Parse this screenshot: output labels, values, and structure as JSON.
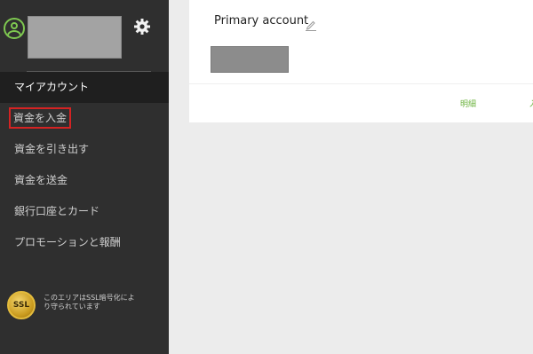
{
  "sidebar": {
    "nav_items": [
      {
        "label": "マイアカウント"
      },
      {
        "label": "資金を入金"
      },
      {
        "label": "資金を引き出す"
      },
      {
        "label": "資金を送金"
      },
      {
        "label": "銀行口座とカード"
      },
      {
        "label": "プロモーションと報酬"
      }
    ],
    "active_index": 0,
    "highlighted_index": 1,
    "ssl_badge_text": "SSL",
    "ssl_notice": "このエリアはSSL暗号化により守られています"
  },
  "main": {
    "account_title": "Primary account",
    "detail_link": "明細",
    "extra_link": "入"
  },
  "colors": {
    "sidebar_bg": "#2f2f2f",
    "active_bg": "#1f1f1f",
    "accent_green": "#6db33f",
    "highlight_red": "#d42323"
  },
  "icons": {
    "avatar": "user-avatar-icon",
    "settings": "gear-icon",
    "edit": "pencil-icon",
    "ssl": "ssl-seal-icon"
  }
}
